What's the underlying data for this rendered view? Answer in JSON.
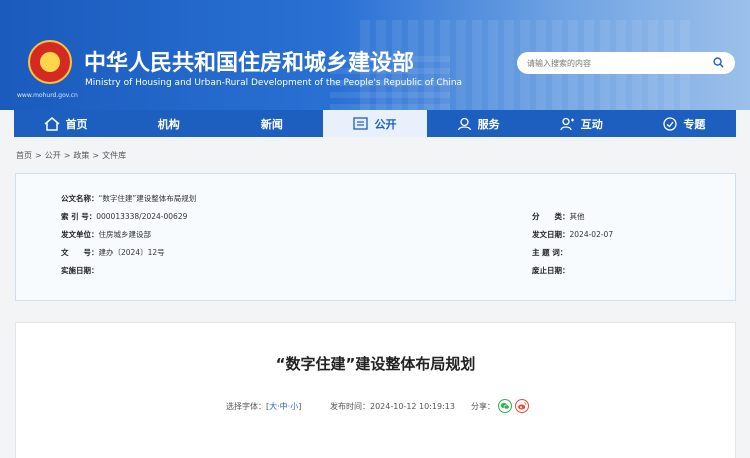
{
  "header": {
    "site_url": "www.mohurd.gov.cn",
    "title_cn": "中华人民共和国住房和城乡建设部",
    "title_en": "Ministry of Housing and Urban-Rural Development of the People's Republic of China",
    "search_placeholder": "请输入搜索的内容"
  },
  "nav": {
    "items": [
      {
        "label": "首页",
        "icon": "home-icon"
      },
      {
        "label": "机构",
        "icon": ""
      },
      {
        "label": "新闻",
        "icon": ""
      },
      {
        "label": "公开",
        "icon": "public-icon"
      },
      {
        "label": "服务",
        "icon": "service-icon"
      },
      {
        "label": "互动",
        "icon": "interact-icon"
      },
      {
        "label": "专题",
        "icon": "topic-icon"
      }
    ],
    "active": "公开"
  },
  "breadcrumb": [
    "首页",
    "公开",
    "政策",
    "文件库"
  ],
  "info": {
    "name_label": "公文名称：",
    "name_value": "“数字住建”建设整体布局规划",
    "index_label": "索 引 号：",
    "index_value": "000013338/2024-00629",
    "category_label": "分　　类：",
    "category_value": "其他",
    "issuer_label": "发文单位：",
    "issuer_value": "住房城乡建设部",
    "date_label": "发文日期：",
    "date_value": "2024-02-07",
    "docno_label": "文　　号：",
    "docno_value": "建办〔2024〕12号",
    "subject_label": "主 题 词：",
    "subject_value": "",
    "effective_label": "实施日期：",
    "effective_value": "",
    "abolish_label": "废止日期：",
    "abolish_value": ""
  },
  "article": {
    "title": "“数字住建”建设整体布局规划",
    "font_label": "选择字体：",
    "font_open": "[",
    "font_large": "大",
    "font_medium": "中",
    "font_small": "小",
    "font_close": "]",
    "publish_label": "发布时间：",
    "publish_time": "2024-10-12 10:19:13",
    "share_label": "分享："
  },
  "colors": {
    "nav_blue": "#1d5fbe",
    "active_bg": "#e8f0fb",
    "link_blue": "#2a64c2"
  }
}
